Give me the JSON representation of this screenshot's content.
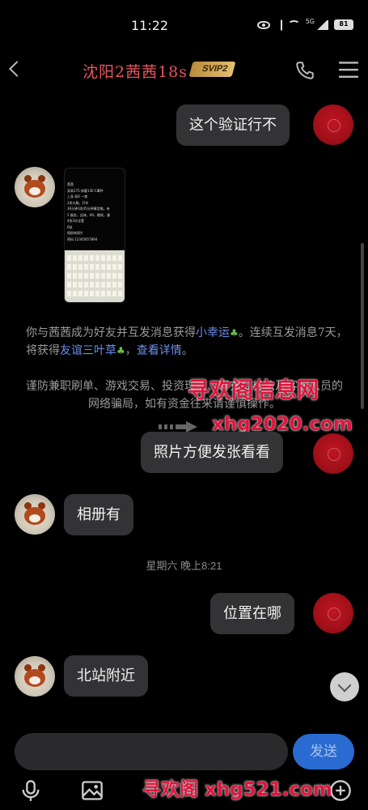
{
  "status_bar": {
    "time": "11:22",
    "network": "5G",
    "battery": "81"
  },
  "header": {
    "title": "沈阳2茜茜18s",
    "vip_badge": "SVIP2"
  },
  "messages": [
    {
      "id": "m1",
      "side": "me",
      "type": "text",
      "text": "这个验证行不"
    },
    {
      "id": "m2",
      "side": "peer",
      "type": "image",
      "image": {
        "lines": [
          "茜茜",
          "身高175  体重130 C罩杯",
          "上身  高4  一夜",
          "2发口服，开车",
          "36分钟3发45分钟事型推。有",
          "5   服务，丝袜，69，睡袋，漫",
          "4张3次全套",
          "6张",
          "相册有照片",
          "密码 12345657894"
        ]
      }
    },
    {
      "id": "sys1",
      "type": "system",
      "parts": [
        "你与茜茜成为好友并互发消息获得",
        "小幸运",
        "。连续互发消息7天，将获得",
        "友谊三叶草",
        "，",
        "查看详情",
        "。"
      ]
    },
    {
      "id": "sys2",
      "type": "system",
      "text": "谨防兼职刷单、游戏交易、投资理财、冒充公检法及客服人员的网络骗局，如有资金往来请谨慎操作。"
    },
    {
      "id": "m3",
      "side": "me",
      "type": "text",
      "text": "照片方便发张看看"
    },
    {
      "id": "m4",
      "side": "peer",
      "type": "text",
      "text": "相册有"
    },
    {
      "id": "sep1",
      "type": "date",
      "text": "星期六 晚上8:21"
    },
    {
      "id": "m5",
      "side": "me",
      "type": "text",
      "text": "位置在哪"
    },
    {
      "id": "m6",
      "side": "peer",
      "type": "text",
      "text": "北站附近"
    }
  ],
  "watermarks": {
    "top_title": "寻欢阁信息网",
    "top_url": "xhg2020.com",
    "bottom": "寻欢阁 xhg521.com"
  },
  "composer": {
    "input_value": "",
    "send_label": "发送"
  },
  "toolbar": {
    "icons": [
      "microphone-icon",
      "image-icon",
      "emoji-icon",
      "plus-icon"
    ]
  },
  "colors": {
    "title": "#e8555f",
    "highlight": "#6d8fe8",
    "send": "#2a6bd1",
    "watermark": "#e0143c"
  }
}
